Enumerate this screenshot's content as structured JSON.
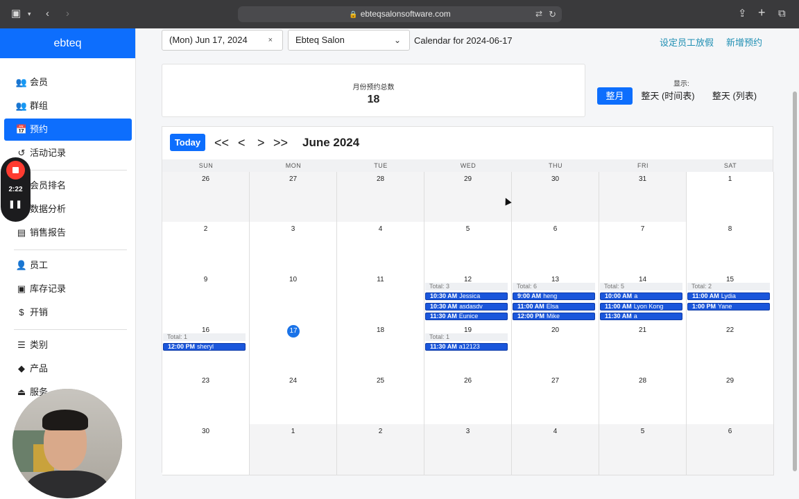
{
  "browser": {
    "url": "ebteqsalonsoftware.com"
  },
  "sidebar": {
    "brand": "ebteq",
    "items": [
      {
        "label": "会员",
        "icon": "users-icon",
        "glyph": "👥"
      },
      {
        "label": "群组",
        "icon": "group-icon",
        "glyph": "👥"
      },
      {
        "label": "预约",
        "icon": "calendar-check-icon",
        "glyph": "📅"
      },
      {
        "label": "活动记录",
        "icon": "history-icon",
        "glyph": "↺"
      },
      {
        "label": "会员排名",
        "icon": "ranking-icon",
        "glyph": "≡"
      },
      {
        "label": "数据分析",
        "icon": "analytics-icon",
        "glyph": "▦"
      },
      {
        "label": "销售报告",
        "icon": "clipboard-icon",
        "glyph": "▤"
      },
      {
        "label": "员工",
        "icon": "user-icon",
        "glyph": "👤"
      },
      {
        "label": "库存记录",
        "icon": "box-icon",
        "glyph": "▣"
      },
      {
        "label": "开销",
        "icon": "dollar-icon",
        "glyph": "$"
      },
      {
        "label": "类别",
        "icon": "list-icon",
        "glyph": "☰"
      },
      {
        "label": "产品",
        "icon": "tags-icon",
        "glyph": "◆"
      },
      {
        "label": "服务",
        "icon": "bell-icon",
        "glyph": "⏏"
      }
    ]
  },
  "recorder": {
    "time": "2:22"
  },
  "toolbar": {
    "date_value": "(Mon) Jun 17, 2024",
    "clear_glyph": "×",
    "salon_value": "Ebteq Salon",
    "calendar_title": "Calendar for 2024-06-17",
    "set_leave_label": "设定员工放假",
    "new_booking_label": "新增预约"
  },
  "summary": {
    "label": "月份预约总数",
    "value": "18"
  },
  "view": {
    "show_label": "显示:",
    "month_label": "整月",
    "day_time_label": "整天 (时间表)",
    "day_list_label": "整天 (列表)"
  },
  "calendar": {
    "today_label": "Today",
    "nav": {
      "first": "<<",
      "prev": "<",
      "next": ">",
      "last": ">>"
    },
    "month_title": "June 2024",
    "weekdays": [
      "SUN",
      "MON",
      "TUE",
      "WED",
      "THU",
      "FRI",
      "SAT"
    ],
    "weeks": [
      [
        {
          "d": "26",
          "other": true
        },
        {
          "d": "27",
          "other": true
        },
        {
          "d": "28",
          "other": true
        },
        {
          "d": "29",
          "other": true
        },
        {
          "d": "30",
          "other": true
        },
        {
          "d": "31",
          "other": true
        },
        {
          "d": "1"
        }
      ],
      [
        {
          "d": "2"
        },
        {
          "d": "3"
        },
        {
          "d": "4"
        },
        {
          "d": "5"
        },
        {
          "d": "6"
        },
        {
          "d": "7"
        },
        {
          "d": "8"
        }
      ],
      [
        {
          "d": "9"
        },
        {
          "d": "10"
        },
        {
          "d": "11"
        },
        {
          "d": "12",
          "total": "Total: 3",
          "events": [
            {
              "time": "10:30 AM",
              "name": "Jessica"
            },
            {
              "time": "10:30 AM",
              "name": "asdasdv"
            },
            {
              "time": "11:30 AM",
              "name": "Eunice"
            }
          ]
        },
        {
          "d": "13",
          "total": "Total: 6",
          "events": [
            {
              "time": "9:00 AM",
              "name": "heng"
            },
            {
              "time": "11:00 AM",
              "name": "Elsa"
            },
            {
              "time": "12:00 PM",
              "name": "Mike"
            }
          ]
        },
        {
          "d": "14",
          "total": "Total: 5",
          "events": [
            {
              "time": "10:00 AM",
              "name": "a"
            },
            {
              "time": "11:00 AM",
              "name": "Lyon Kong"
            },
            {
              "time": "11:30 AM",
              "name": "a"
            }
          ]
        },
        {
          "d": "15",
          "total": "Total: 2",
          "events": [
            {
              "time": "11:00 AM",
              "name": "Lydia"
            },
            {
              "time": "1:00 PM",
              "name": "Yane"
            }
          ]
        }
      ],
      [
        {
          "d": "16",
          "total": "Total: 1",
          "events": [
            {
              "time": "12:00 PM",
              "name": "sheryl"
            }
          ]
        },
        {
          "d": "17",
          "today": true
        },
        {
          "d": "18"
        },
        {
          "d": "19",
          "total": "Total: 1",
          "events": [
            {
              "time": "11:30 AM",
              "name": "a12123"
            }
          ]
        },
        {
          "d": "20"
        },
        {
          "d": "21"
        },
        {
          "d": "22"
        }
      ],
      [
        {
          "d": "23"
        },
        {
          "d": "24"
        },
        {
          "d": "25"
        },
        {
          "d": "26"
        },
        {
          "d": "27"
        },
        {
          "d": "28"
        },
        {
          "d": "29"
        }
      ],
      [
        {
          "d": "30"
        },
        {
          "d": "1",
          "other": true
        },
        {
          "d": "2",
          "other": true
        },
        {
          "d": "3",
          "other": true
        },
        {
          "d": "4",
          "other": true
        },
        {
          "d": "5",
          "other": true
        },
        {
          "d": "6",
          "other": true
        }
      ]
    ]
  }
}
